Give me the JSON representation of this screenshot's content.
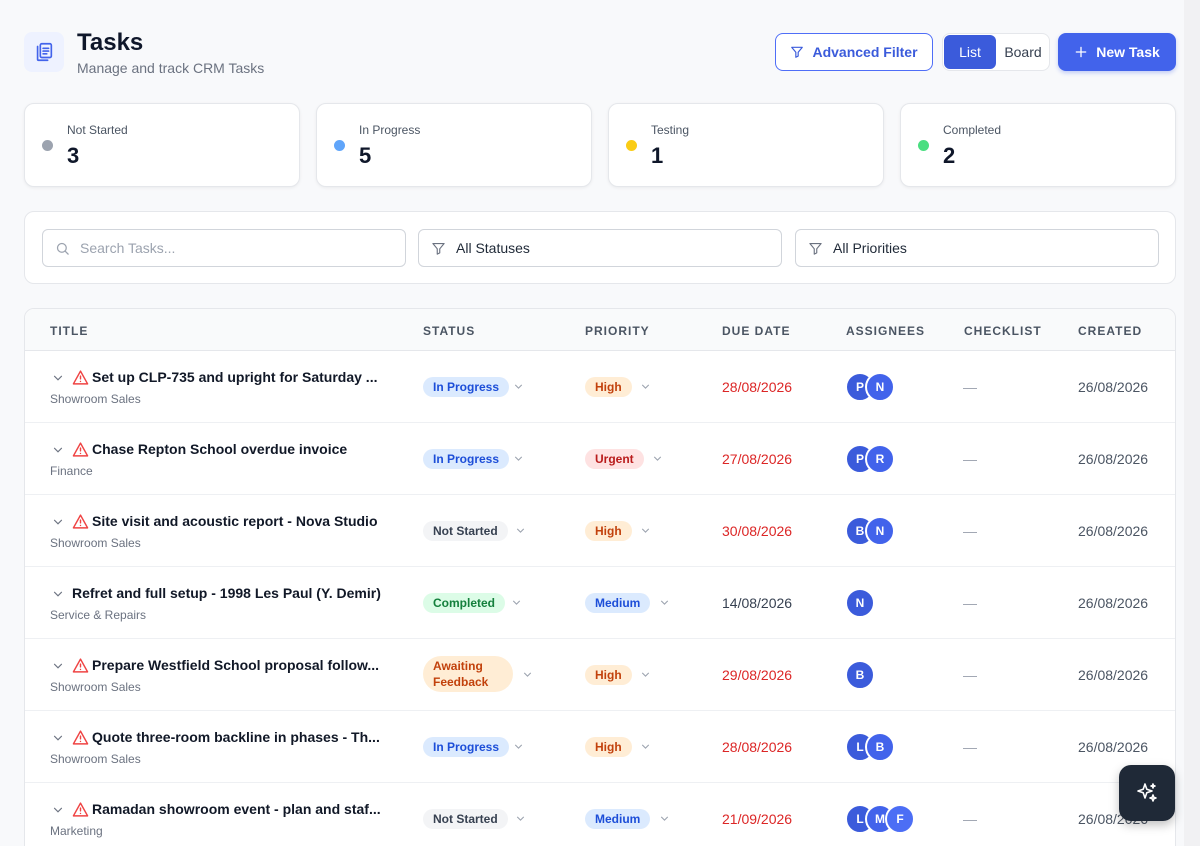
{
  "header": {
    "title": "Tasks",
    "subtitle": "Manage and track CRM Tasks",
    "advanced_filter_label": "Advanced Filter",
    "view_list_label": "List",
    "view_board_label": "Board",
    "new_task_label": "New Task"
  },
  "stats": [
    {
      "label": "Not Started",
      "value": "3",
      "color": "#9ca3af"
    },
    {
      "label": "In Progress",
      "value": "5",
      "color": "#60a5fa"
    },
    {
      "label": "Testing",
      "value": "1",
      "color": "#facc15"
    },
    {
      "label": "Completed",
      "value": "2",
      "color": "#4ade80"
    }
  ],
  "filters": {
    "search_placeholder": "Search Tasks...",
    "status_value": "All Statuses",
    "priority_value": "All Priorities"
  },
  "table": {
    "columns": [
      "TITLE",
      "STATUS",
      "PRIORITY",
      "DUE DATE",
      "ASSIGNEES",
      "CHECKLIST",
      "CREATED"
    ],
    "rows": [
      {
        "title": "Set up CLP-735 and upright for Saturday ...",
        "category": "Showroom Sales",
        "status": "In Progress",
        "priority": "High",
        "due": "28/08/2026",
        "assignees": [
          "P",
          "N"
        ],
        "checklist": "—",
        "created": "26/08/2026"
      },
      {
        "title": "Chase Repton School overdue invoice",
        "category": "Finance",
        "status": "In Progress",
        "priority": "Urgent",
        "due": "27/08/2026",
        "assignees": [
          "P",
          "R"
        ],
        "checklist": "—",
        "created": "26/08/2026"
      },
      {
        "title": "Site visit and acoustic report - Nova Studio",
        "category": "Showroom Sales",
        "status": "Not Started",
        "priority": "High",
        "due": "30/08/2026",
        "assignees": [
          "B",
          "N"
        ],
        "checklist": "—",
        "created": "26/08/2026"
      },
      {
        "title": "Refret and full setup - 1998 Les Paul (Y. Demir)",
        "category": "Service & Repairs",
        "status": "Completed",
        "priority": "Medium",
        "due": "14/08/2026",
        "assignees": [
          "N"
        ],
        "checklist": "—",
        "created": "26/08/2026"
      },
      {
        "title": "Prepare Westfield School proposal follow...",
        "category": "Showroom Sales",
        "status_line1": "Awaiting",
        "status_line2": "Feedback",
        "priority": "High",
        "due": "29/08/2026",
        "assignees": [
          "B"
        ],
        "checklist": "—",
        "created": "26/08/2026"
      },
      {
        "title": "Quote three-room backline in phases - Th...",
        "category": "Showroom Sales",
        "status": "In Progress",
        "priority": "High",
        "due": "28/08/2026",
        "assignees": [
          "L",
          "B"
        ],
        "checklist": "—",
        "created": "26/08/2026"
      },
      {
        "title": "Ramadan showroom event - plan and staf...",
        "category": "Marketing",
        "status": "Not Started",
        "priority": "Medium",
        "due": "21/09/2026",
        "assignees": [
          "L",
          "M",
          "F"
        ],
        "checklist": "—",
        "created": "26/08/2026"
      }
    ]
  },
  "icons": {
    "title": "clipboard-icon",
    "advanced_filter": "funnel-icon",
    "new_task": "plus-icon",
    "row_toggle": "chevron-down-icon",
    "overdue": "warning-triangle-icon",
    "fab": "sparkles-icon"
  },
  "colors": {
    "accent": "#4263eb",
    "overdue": "#dc2626"
  }
}
